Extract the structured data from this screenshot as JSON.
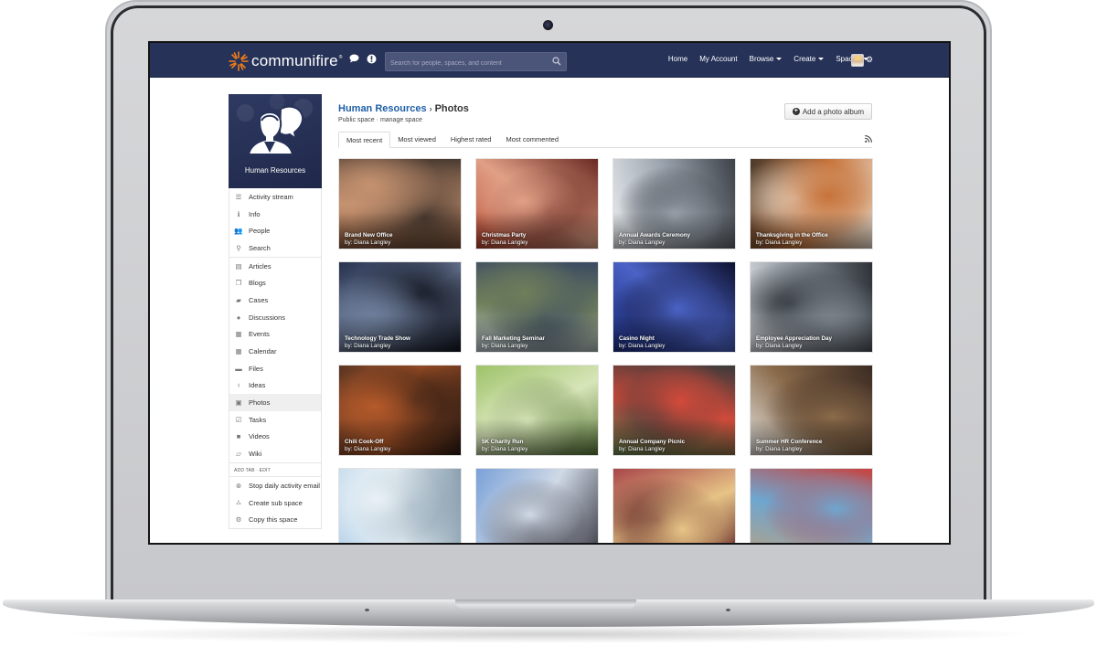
{
  "app": {
    "brand": "communifire",
    "brand_mark": "®",
    "brand_color": "#f07c1b",
    "topbar_color": "#263258"
  },
  "topbar": {
    "search_placeholder": "Search for people, spaces, and content",
    "icons": [
      "chat-icon",
      "alert-icon",
      "search-icon",
      "gear-icon"
    ],
    "nav": [
      {
        "label": "Home",
        "dropdown": false
      },
      {
        "label": "My Account",
        "dropdown": false
      },
      {
        "label": "Browse",
        "dropdown": true
      },
      {
        "label": "Create",
        "dropdown": true
      },
      {
        "label": "Spaces",
        "dropdown": true
      }
    ]
  },
  "sidebar": {
    "space_name": "Human Resources",
    "items": [
      {
        "label": "Activity stream",
        "icon": "list-icon"
      },
      {
        "label": "Info",
        "icon": "info-icon"
      },
      {
        "label": "People",
        "icon": "people-icon"
      },
      {
        "label": "Search",
        "icon": "search-icon"
      },
      {
        "label": "Articles",
        "icon": "article-icon"
      },
      {
        "label": "Blogs",
        "icon": "blog-icon"
      },
      {
        "label": "Cases",
        "icon": "briefcase-icon"
      },
      {
        "label": "Discussions",
        "icon": "comments-icon"
      },
      {
        "label": "Events",
        "icon": "calendar-icon"
      },
      {
        "label": "Calendar",
        "icon": "calendar-icon"
      },
      {
        "label": "Files",
        "icon": "folder-icon"
      },
      {
        "label": "Ideas",
        "icon": "lightbulb-icon"
      },
      {
        "label": "Photos",
        "icon": "image-icon",
        "active": true
      },
      {
        "label": "Tasks",
        "icon": "checkbox-icon"
      },
      {
        "label": "Videos",
        "icon": "video-icon"
      },
      {
        "label": "Wiki",
        "icon": "wiki-icon"
      }
    ],
    "tab_actions": {
      "add": "ADD TAB",
      "sep": "·",
      "edit": "EDIT"
    },
    "actions": [
      {
        "label": "Stop daily activity email",
        "icon": "stop-icon"
      },
      {
        "label": "Create sub space",
        "icon": "sitemap-icon"
      },
      {
        "label": "Copy this space",
        "icon": "copy-icon"
      }
    ]
  },
  "main": {
    "breadcrumb_parent": "Human Resources",
    "breadcrumb_sep": "›",
    "breadcrumb_current": "Photos",
    "visibility": "Public space",
    "sub_sep": " · ",
    "manage": "manage space",
    "add_button": "Add a photo album",
    "tabs": [
      {
        "label": "Most recent",
        "active": true
      },
      {
        "label": "Most viewed"
      },
      {
        "label": "Highest rated"
      },
      {
        "label": "Most commented"
      }
    ],
    "albums": [
      {
        "title": "Brand New Office",
        "author": "by: Diana Langley",
        "palette": [
          "#8a5a3c",
          "#c59270",
          "#4a3a30"
        ]
      },
      {
        "title": "Christmas Party",
        "author": "by: Diana Langley",
        "palette": [
          "#b5432e",
          "#e0a086",
          "#6a2a22"
        ]
      },
      {
        "title": "Annual Awards Ceremony",
        "author": "by: Diana Langley",
        "palette": [
          "#e9ecef",
          "#9aa3ad",
          "#3d4148"
        ]
      },
      {
        "title": "Thanksgiving in the Office",
        "author": "by: Diana Langley",
        "palette": [
          "#4a3a2c",
          "#c7733a",
          "#e8dccd"
        ]
      },
      {
        "title": "Technology Trade Show",
        "author": "by: Diana Langley",
        "palette": [
          "#27324e",
          "#6d7d9a",
          "#121520"
        ]
      },
      {
        "title": "Fall Marketing Seminar",
        "author": "by: Diana Langley",
        "palette": [
          "#c3cfd8",
          "#6f7e5a",
          "#3a4a62"
        ]
      },
      {
        "title": "Casino Night",
        "author": "by: Diana Langley",
        "palette": [
          "#1d2f86",
          "#4b63c6",
          "#0e1230"
        ]
      },
      {
        "title": "Employee Appreciation Day",
        "author": "by: Diana Langley",
        "palette": [
          "#dadfe3",
          "#7f8790",
          "#2e3238"
        ]
      },
      {
        "title": "Chili Cook-Off",
        "author": "by: Diana Langley",
        "palette": [
          "#5a3522",
          "#b65a2a",
          "#2a1a12"
        ]
      },
      {
        "title": "5K Charity Run",
        "author": "by: Diana Langley",
        "palette": [
          "#9ec36a",
          "#d7e5b8",
          "#5b7a3a"
        ]
      },
      {
        "title": "Annual Company Picnic",
        "author": "by: Diana Langley",
        "palette": [
          "#6a8a52",
          "#d24a3a",
          "#3a3a3a"
        ]
      },
      {
        "title": "Summer HR Conference",
        "author": "by: Diana Langley",
        "palette": [
          "#e3e1dc",
          "#8a6a4a",
          "#3a2a22"
        ]
      },
      {
        "title": "",
        "author": "",
        "palette": [
          "#bcd6ea",
          "#e9f1f6",
          "#8aa0b0"
        ]
      },
      {
        "title": "",
        "author": "",
        "palette": [
          "#7aa1d8",
          "#cfd9e6",
          "#3a3a44"
        ]
      },
      {
        "title": "",
        "author": "",
        "palette": [
          "#a8464a",
          "#e7c486",
          "#5a1e22"
        ]
      },
      {
        "title": "",
        "author": "",
        "palette": [
          "#b6a184",
          "#6ea6d0",
          "#c8433f"
        ]
      }
    ]
  }
}
